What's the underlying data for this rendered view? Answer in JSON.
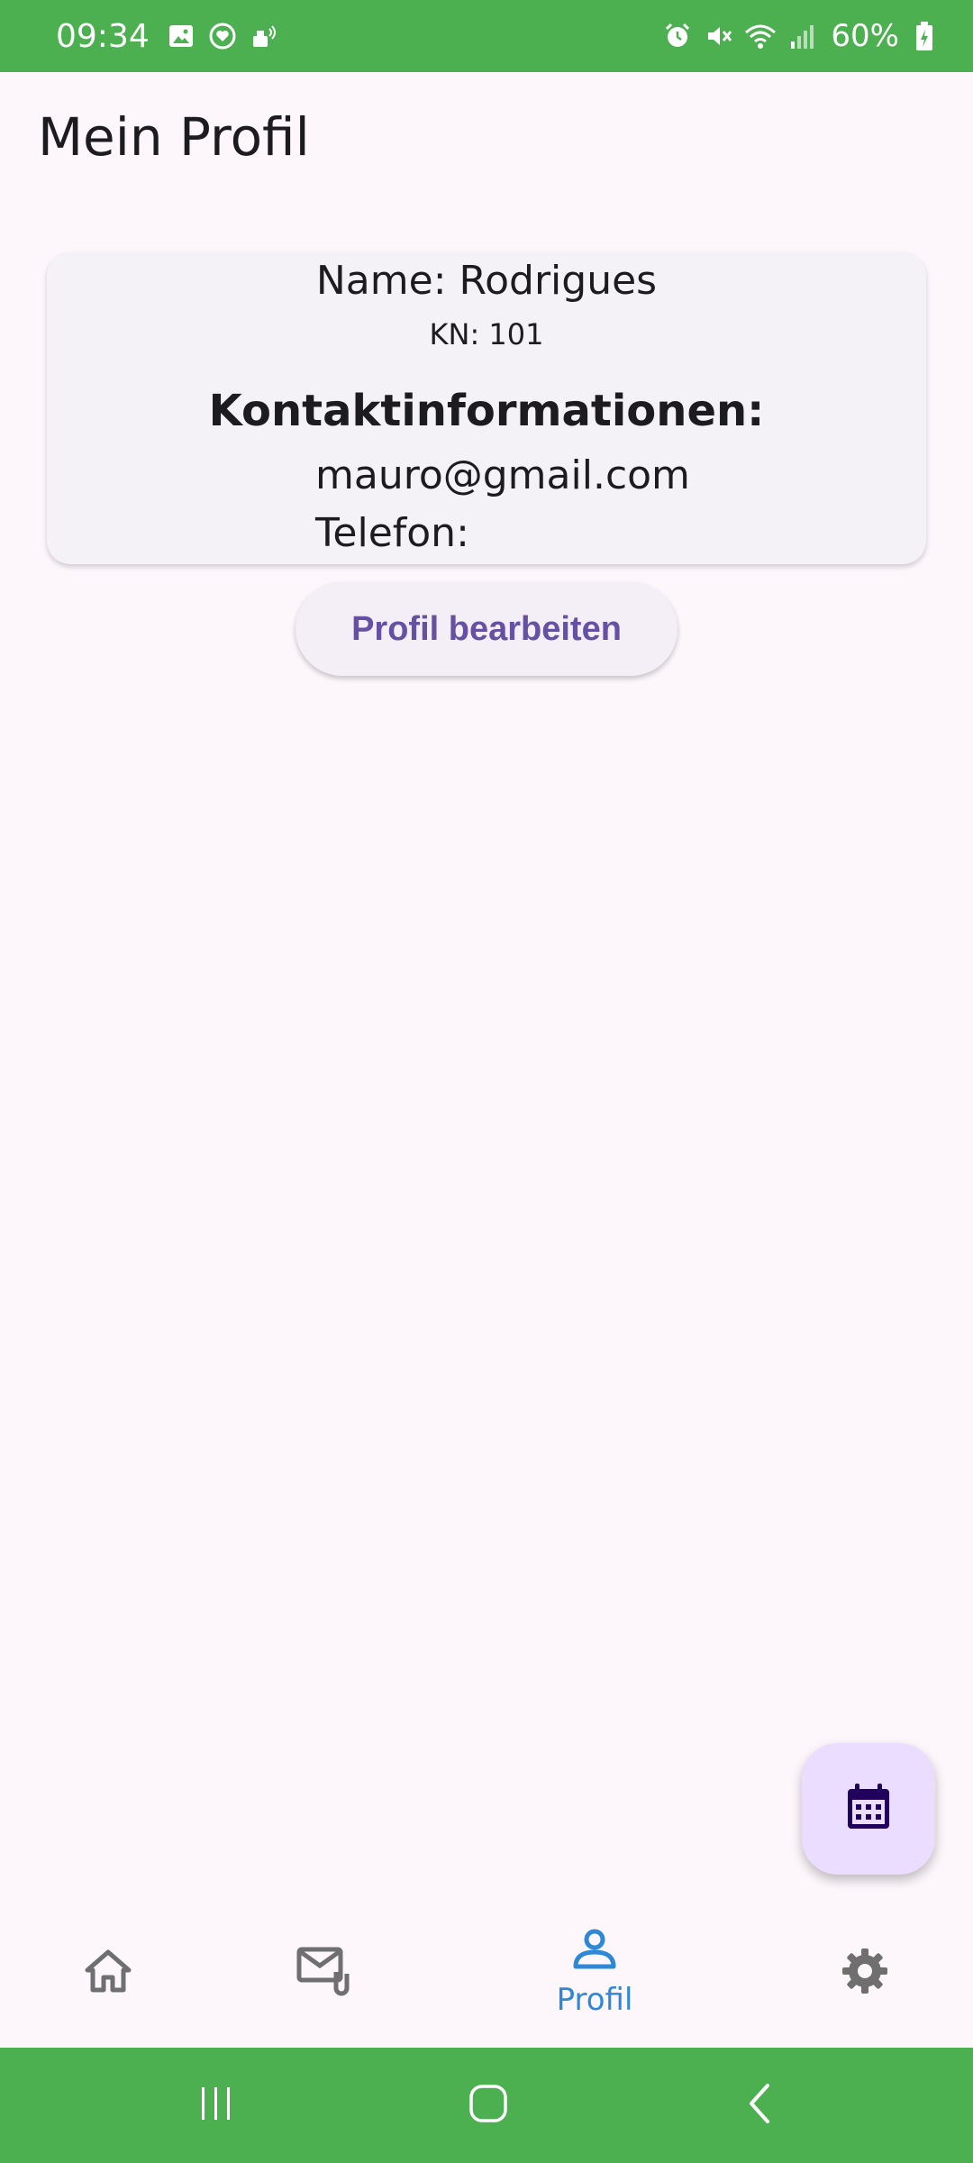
{
  "status_bar": {
    "time": "09:34",
    "battery": "60%",
    "left_icons": [
      "image-icon",
      "heart-badge-icon",
      "nfc-pay-icon"
    ],
    "right_icons": [
      "alarm-icon",
      "mute-icon",
      "wifi-icon",
      "signal-icon",
      "battery-icon"
    ]
  },
  "header": {
    "title": "Mein Profil"
  },
  "profile": {
    "name": "Name: Rodrigues",
    "kn": "KN: 101",
    "contact_heading": "Kontaktinformationen:",
    "email": "mauro@gmail.com",
    "phone": "Telefon:"
  },
  "actions": {
    "edit_label": "Profil bearbeiten",
    "fab_icon": "calendar-icon"
  },
  "bottom_nav": {
    "items": [
      {
        "icon": "home-icon",
        "label": ""
      },
      {
        "icon": "mail-attachment-icon",
        "label": ""
      },
      {
        "icon": "person-icon",
        "label": "Profil",
        "active": true
      },
      {
        "icon": "gear-icon",
        "label": ""
      }
    ]
  },
  "colors": {
    "status_bar": "#4caf50",
    "accent": "#6650a4",
    "nav_active": "#2e88d6",
    "fab_bg": "#eaddff",
    "background": "#fdf7fc"
  }
}
